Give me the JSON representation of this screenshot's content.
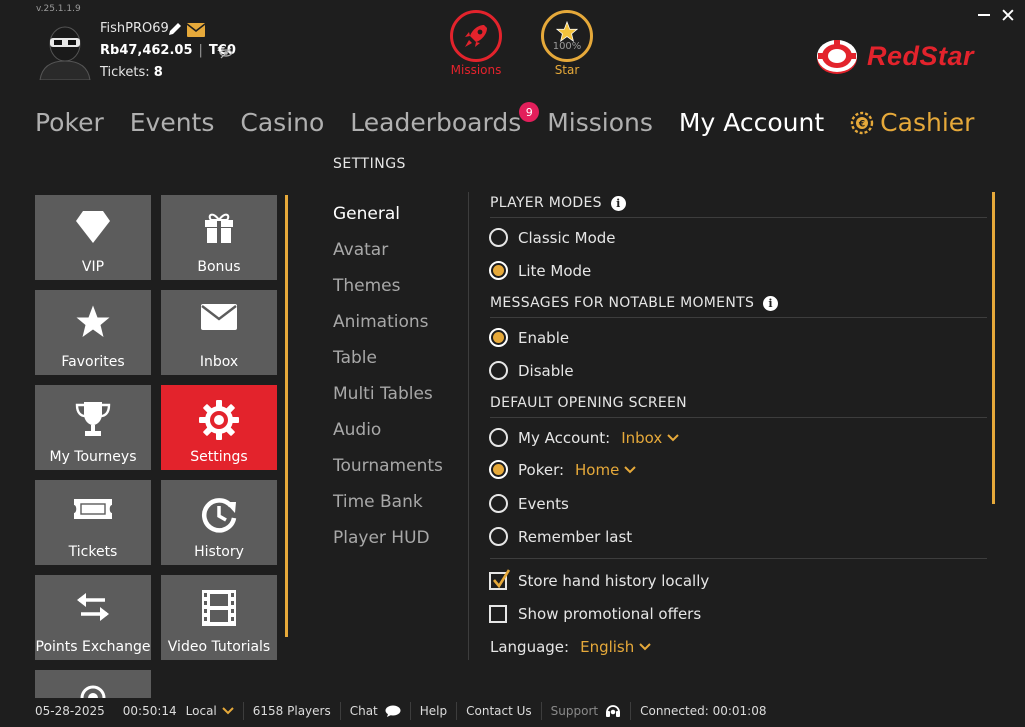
{
  "header": {
    "version": "v.25.1.1.9",
    "username": "FishPRO69",
    "balance": "Rb47,462.05",
    "t_balance": "T€0",
    "tickets_label": "Tickets:",
    "tickets_count": "8",
    "missions_label": "Missions",
    "star_label": "Star",
    "star_percent": "100%",
    "brand": "RedStar"
  },
  "nav": {
    "items": [
      "Poker",
      "Events",
      "Casino",
      "Leaderboards",
      "Missions",
      "My Account",
      "Cashier"
    ],
    "active": "My Account",
    "leaderboards_badge": "9"
  },
  "page": {
    "heading": "SETTINGS"
  },
  "tiles": [
    {
      "label": "VIP",
      "icon": "diamond-icon"
    },
    {
      "label": "Bonus",
      "icon": "gift-icon"
    },
    {
      "label": "Favorites",
      "icon": "star-icon"
    },
    {
      "label": "Inbox",
      "icon": "envelope-icon"
    },
    {
      "label": "My Tourneys",
      "icon": "trophy-icon"
    },
    {
      "label": "Settings",
      "icon": "gear-icon",
      "active": true
    },
    {
      "label": "Tickets",
      "icon": "ticket-icon"
    },
    {
      "label": "History",
      "icon": "history-icon"
    },
    {
      "label": "Points Exchange",
      "icon": "exchange-icon"
    },
    {
      "label": "Video Tutorials",
      "icon": "film-icon"
    }
  ],
  "submenu": {
    "items": [
      "General",
      "Avatar",
      "Themes",
      "Animations",
      "Table",
      "Multi Tables",
      "Audio",
      "Tournaments",
      "Time Bank",
      "Player HUD"
    ],
    "active": "General"
  },
  "settings": {
    "player_modes": {
      "title": "PLAYER MODES",
      "options": [
        "Classic Mode",
        "Lite Mode"
      ],
      "selected": "Lite Mode"
    },
    "notable_moments": {
      "title": "MESSAGES FOR NOTABLE MOMENTS",
      "options": [
        "Enable",
        "Disable"
      ],
      "selected": "Enable"
    },
    "opening_screen": {
      "title": "DEFAULT OPENING SCREEN",
      "my_account_label": "My Account:",
      "my_account_value": "Inbox",
      "poker_label": "Poker:",
      "poker_value": "Home",
      "events_label": "Events",
      "remember_label": "Remember last",
      "selected": "Poker"
    },
    "store_history": {
      "label": "Store hand history locally",
      "checked": true
    },
    "promo_offers": {
      "label": "Show promotional offers",
      "checked": false
    },
    "language_label": "Language:",
    "language_value": "English"
  },
  "status": {
    "date": "05-28-2025",
    "time": "00:50:14",
    "timezone": "Local",
    "players": "6158 Players",
    "chat": "Chat",
    "help": "Help",
    "contact": "Contact Us",
    "support": "Support",
    "connected": "Connected: 00:01:08"
  },
  "colors": {
    "accent": "#e6a93a",
    "brand_red": "#e3232c",
    "tile_bg": "#5c5c5c",
    "badge": "#e31f5b",
    "background": "#1e1e1e"
  }
}
